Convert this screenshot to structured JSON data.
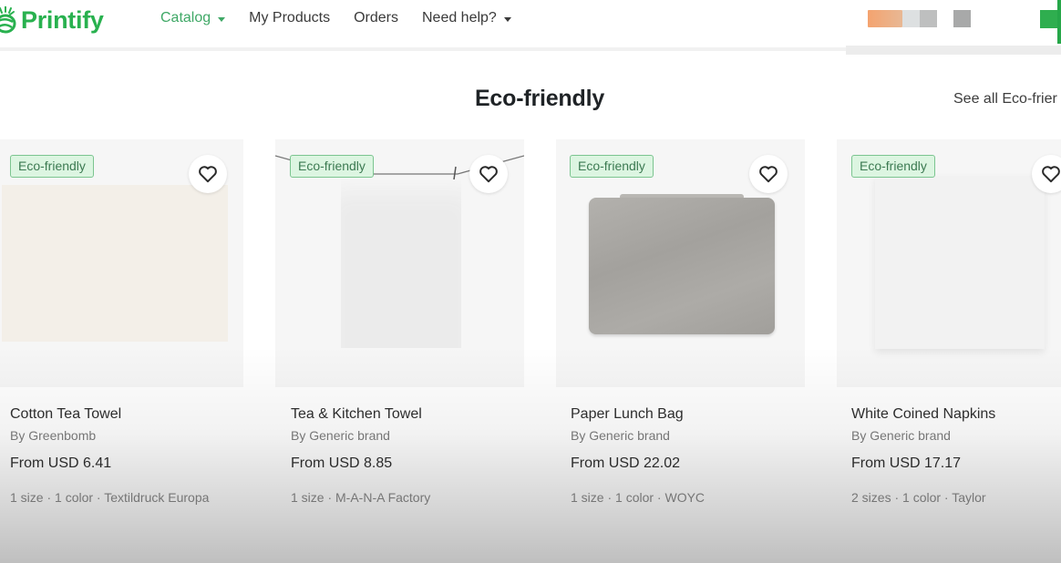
{
  "header": {
    "logo_text": "Printify",
    "nav": [
      {
        "label": "Catalog",
        "has_dropdown": true,
        "active": true
      },
      {
        "label": "My Products",
        "has_dropdown": false,
        "active": false
      },
      {
        "label": "Orders",
        "has_dropdown": false,
        "active": false
      },
      {
        "label": "Need help?",
        "has_dropdown": true,
        "active": false
      }
    ]
  },
  "section": {
    "title": "Eco-friendly",
    "see_all_label": "See all Eco-frier"
  },
  "colors": {
    "brand": "#29b14f",
    "badge_bg": "#dcf5e1",
    "badge_text": "#3c7a52"
  },
  "products": [
    {
      "badge": "Eco-friendly",
      "name": "Cotton Tea Towel",
      "brand": "By Greenbomb",
      "price": "From USD 6.41",
      "meta": "1 size · 1 color · Textildruck Europa"
    },
    {
      "badge": "Eco-friendly",
      "name": "Tea & Kitchen Towel",
      "brand": "By Generic brand",
      "price": "From USD 8.85",
      "meta": "1 size · M-A-N-A Factory"
    },
    {
      "badge": "Eco-friendly",
      "name": "Paper Lunch Bag",
      "brand": "By Generic brand",
      "price": "From USD 22.02",
      "meta": "1 size · 1 color · WOYC"
    },
    {
      "badge": "Eco-friendly",
      "name": "White Coined Napkins",
      "brand": "By Generic brand",
      "price": "From USD 17.17",
      "meta": "2 sizes · 1 color · Taylor"
    }
  ]
}
